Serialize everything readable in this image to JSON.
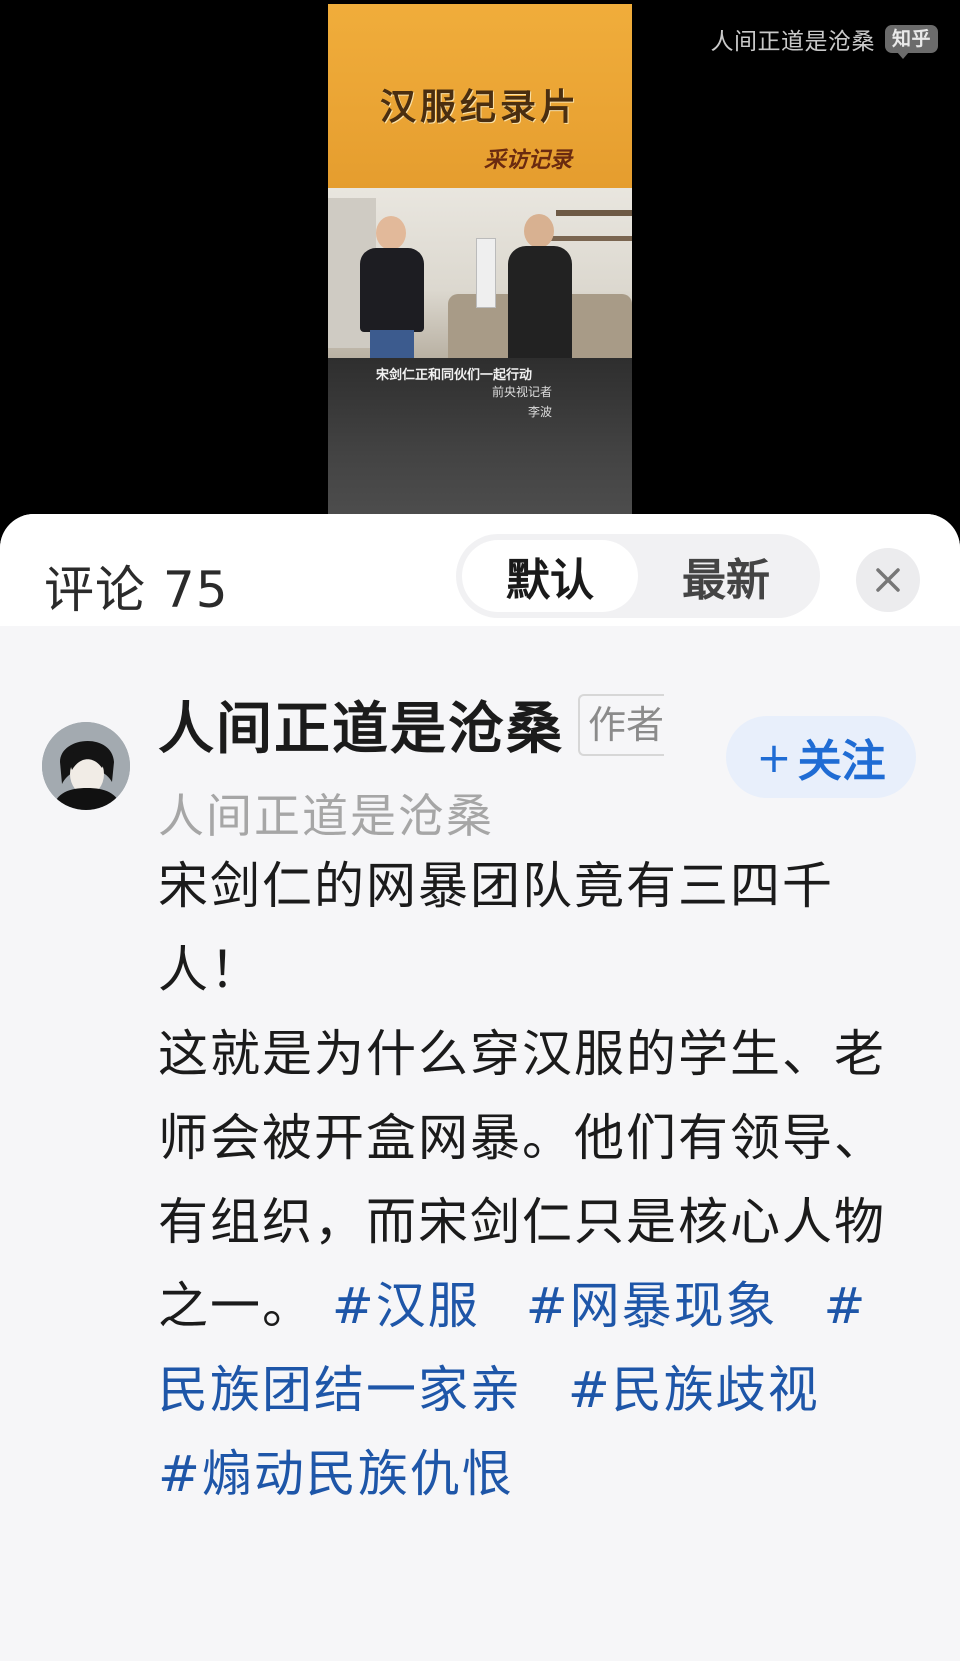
{
  "watermark": {
    "text": "人间正道是沧桑",
    "badge": "知乎"
  },
  "video": {
    "title": "汉服纪录片",
    "subtitle": "采访记录",
    "caption": "宋剑仁正和同伙们一起行动",
    "credit_line1": "前央视记者",
    "credit_line2": "李波"
  },
  "sheet": {
    "comment_count_label": "评论 75",
    "tabs": [
      {
        "label": "默认",
        "active": true
      },
      {
        "label": "最新",
        "active": false
      }
    ]
  },
  "comment": {
    "author": "人间正道是沧桑",
    "author_tag": "作者",
    "author_sub": "人间正道是沧桑",
    "follow_label": "关注",
    "follow_plus": "+",
    "text_lines": [
      "宋剑仁的网暴团队竟有三四千人！",
      "这就是为什么穿汉服的学生、老师会被开盒网暴。他们有领导、有组织，而宋剑仁只是核心人物之一。"
    ],
    "hashtags": [
      "#汉服",
      "#网暴现象",
      "#民族团结一家亲",
      "#民族歧视",
      "#煽动民族仇恨"
    ]
  },
  "colors": {
    "follow_text": "#1f6cd4",
    "follow_bg": "#e8effb",
    "hashtag": "#1e56a8",
    "video_title_bg": "#f0ad3b"
  }
}
